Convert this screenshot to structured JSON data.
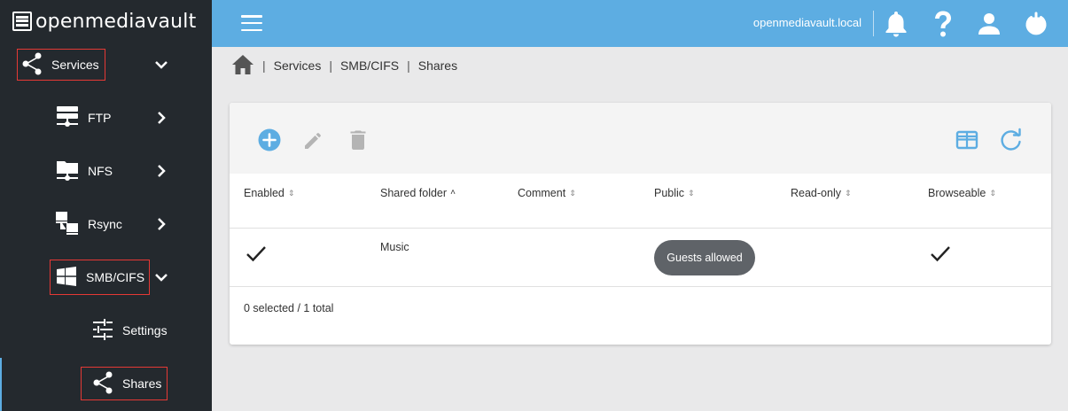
{
  "app": {
    "logo_text": "openmediavault",
    "hostname": "openmediavault.local"
  },
  "sidebar": {
    "items": [
      {
        "label": "Services",
        "icon": "share-icon",
        "expanded": true
      },
      {
        "label": "FTP",
        "icon": "server-icon"
      },
      {
        "label": "NFS",
        "icon": "network-folder-icon"
      },
      {
        "label": "Rsync",
        "icon": "computer-sync-icon"
      },
      {
        "label": "SMB/CIFS",
        "icon": "windows-icon",
        "expanded": true
      },
      {
        "label": "Settings",
        "icon": "tune-icon"
      },
      {
        "label": "Shares",
        "icon": "share-icon",
        "active": true
      }
    ]
  },
  "topbar": {
    "icons": [
      "bell-icon",
      "help-icon",
      "user-icon",
      "power-icon"
    ]
  },
  "breadcrumb": {
    "items": [
      "Services",
      "SMB/CIFS",
      "Shares"
    ]
  },
  "toolbar": {
    "icons": [
      "add-icon",
      "edit-icon",
      "delete-icon",
      "column-toggle-icon",
      "refresh-icon"
    ]
  },
  "table": {
    "columns": [
      "Enabled",
      "Shared folder",
      "Comment",
      "Public",
      "Read-only",
      "Browseable"
    ],
    "sorted_column": "Shared folder",
    "rows": [
      {
        "enabled": true,
        "shared_folder": "Music",
        "comment": "",
        "public": "Guests allowed",
        "read_only": false,
        "browseable": true
      }
    ],
    "footer": "0 selected / 1 total"
  },
  "colors": {
    "sidebar": "#24292e",
    "topbar": "#5dade2",
    "accent": "#5dade2",
    "badge": "#5f6368",
    "highlight_box": "#e53935"
  }
}
